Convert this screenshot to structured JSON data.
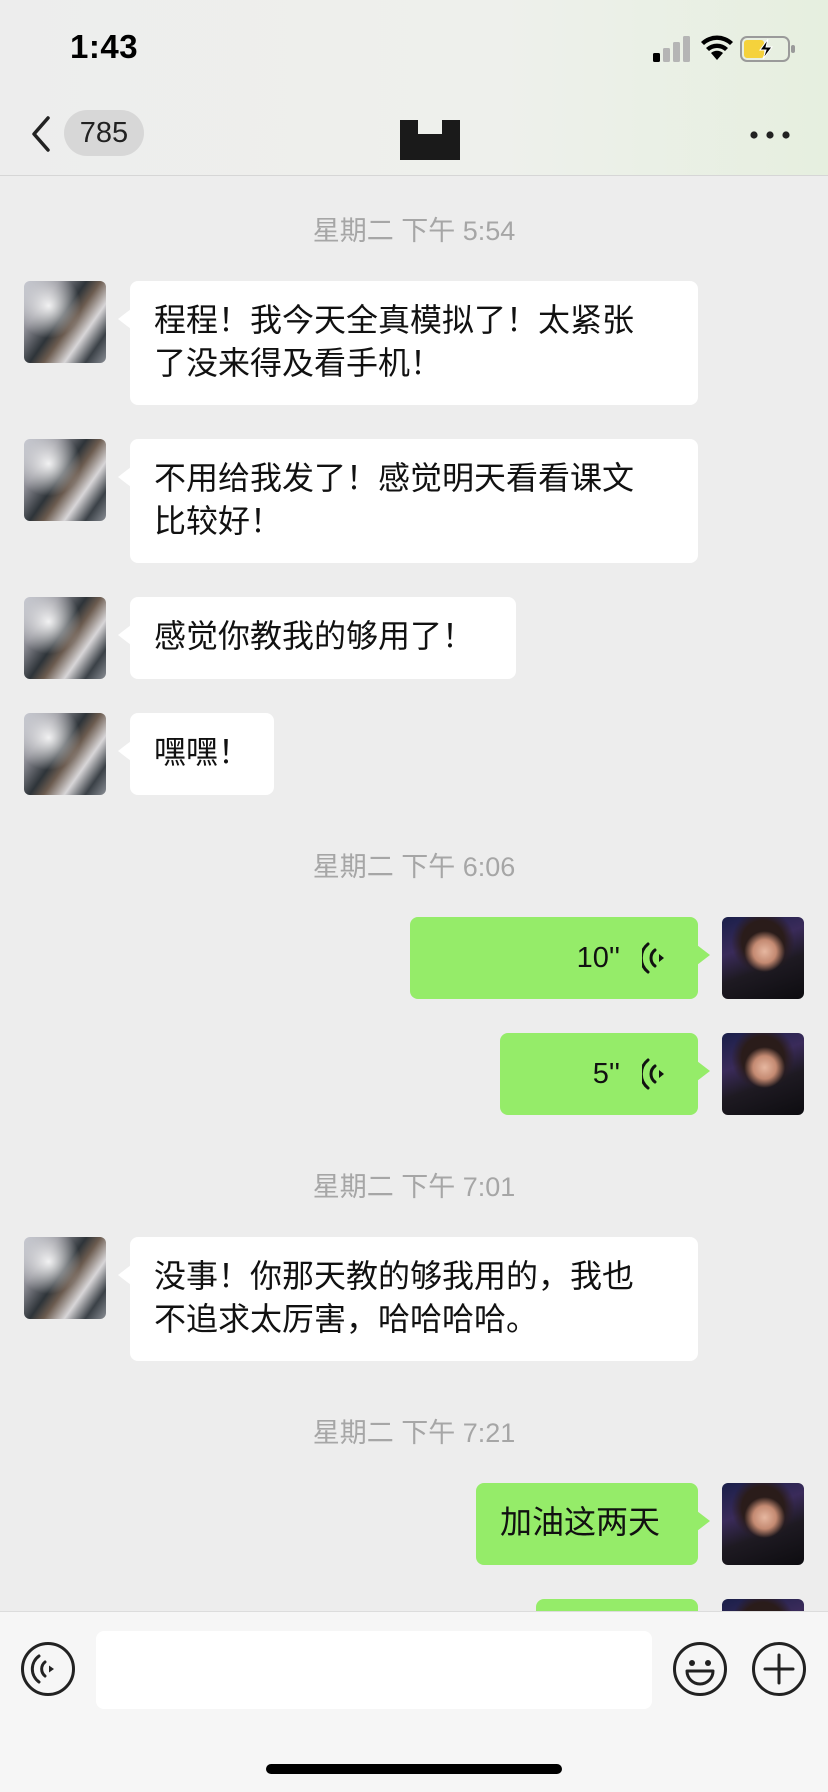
{
  "status_bar": {
    "time": "1:43",
    "signal_icon": "cellular-signal-icon",
    "wifi_icon": "wifi-icon",
    "battery_icon": "battery-charging-icon",
    "battery_color": "#f5d23c"
  },
  "nav": {
    "back_icon": "chevron-left-icon",
    "unread_count": "785",
    "more_icon": "ellipsis-icon"
  },
  "colors": {
    "background": "#ededed",
    "incoming_bubble": "#ffffff",
    "outgoing_bubble": "#95ec69",
    "timestamp_text": "#a6a6a6"
  },
  "messages": [
    {
      "type": "timestamp",
      "text": "星期二 下午 5:54"
    },
    {
      "type": "incoming",
      "lines": [
        "程程！我今天全真模拟了！太紧张",
        "了没来得及看手机！"
      ]
    },
    {
      "type": "incoming",
      "lines": [
        "不用给我发了！感觉明天看看课文",
        "比较好！"
      ]
    },
    {
      "type": "incoming",
      "lines": [
        "感觉你教我的够用了！"
      ]
    },
    {
      "type": "incoming",
      "lines": [
        "嘿嘿！"
      ]
    },
    {
      "type": "timestamp",
      "text": "星期二 下午 6:06"
    },
    {
      "type": "outgoing-voice",
      "duration": "10''"
    },
    {
      "type": "outgoing-voice",
      "duration": "5''"
    },
    {
      "type": "timestamp",
      "text": "星期二 下午 7:01"
    },
    {
      "type": "incoming",
      "lines": [
        "没事！你那天教的够我用的，我也",
        "不追求太厉害，哈哈哈哈。"
      ]
    },
    {
      "type": "timestamp",
      "text": "星期二 下午 7:21"
    },
    {
      "type": "outgoing",
      "lines": [
        "加油这两天"
      ]
    }
  ],
  "input_bar": {
    "voice_toggle_icon": "voice-input-icon",
    "text_value": "",
    "emoji_icon": "emoji-icon",
    "plus_icon": "plus-circle-icon"
  }
}
